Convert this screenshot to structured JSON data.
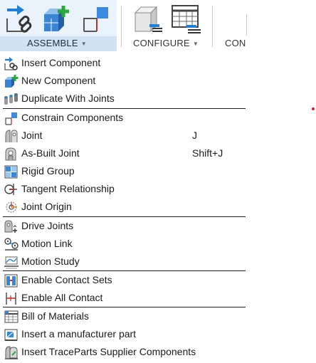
{
  "ribbon": {
    "tabs": [
      {
        "label": "ASSEMBLE",
        "has_caret": true
      },
      {
        "label": "CONFIGURE",
        "has_caret": true
      },
      {
        "label": "CON",
        "has_caret": false
      }
    ],
    "tools": [
      "insert-component-icon",
      "new-component-icon",
      "constrain-components-icon",
      "configure-table-icon",
      "configure-grid-icon"
    ],
    "accent": "#1e7fd8",
    "active_tab_bg": "#cfe3f4"
  },
  "menu": {
    "items": [
      {
        "label": "Insert Component",
        "icon": "insert-component-icon",
        "shortcut": ""
      },
      {
        "label": "New Component",
        "icon": "new-component-icon",
        "shortcut": ""
      },
      {
        "label": "Duplicate With Joints",
        "icon": "duplicate-with-joints-icon",
        "shortcut": ""
      },
      {
        "label": "Constrain Components",
        "icon": "constrain-components-icon",
        "shortcut": ""
      },
      {
        "label": "Joint",
        "icon": "joint-icon",
        "shortcut": "J"
      },
      {
        "label": "As-Built Joint",
        "icon": "as-built-joint-icon",
        "shortcut": "Shift+J"
      },
      {
        "label": "Rigid Group",
        "icon": "rigid-group-icon",
        "shortcut": ""
      },
      {
        "label": "Tangent Relationship",
        "icon": "tangent-relationship-icon",
        "shortcut": ""
      },
      {
        "label": "Joint Origin",
        "icon": "joint-origin-icon",
        "shortcut": ""
      },
      {
        "label": "Drive Joints",
        "icon": "drive-joints-icon",
        "shortcut": ""
      },
      {
        "label": "Motion Link",
        "icon": "motion-link-icon",
        "shortcut": ""
      },
      {
        "label": "Motion Study",
        "icon": "motion-study-icon",
        "shortcut": ""
      },
      {
        "label": "Enable Contact Sets",
        "icon": "enable-contact-sets-icon",
        "shortcut": ""
      },
      {
        "label": "Enable All Contact",
        "icon": "enable-all-contact-icon",
        "shortcut": ""
      },
      {
        "label": "Bill of Materials",
        "icon": "bill-of-materials-icon",
        "shortcut": ""
      },
      {
        "label": "Insert a manufacturer part",
        "icon": "manufacturer-part-icon",
        "shortcut": ""
      },
      {
        "label": "Insert TraceParts Supplier Components",
        "icon": "traceparts-icon",
        "shortcut": ""
      }
    ]
  }
}
